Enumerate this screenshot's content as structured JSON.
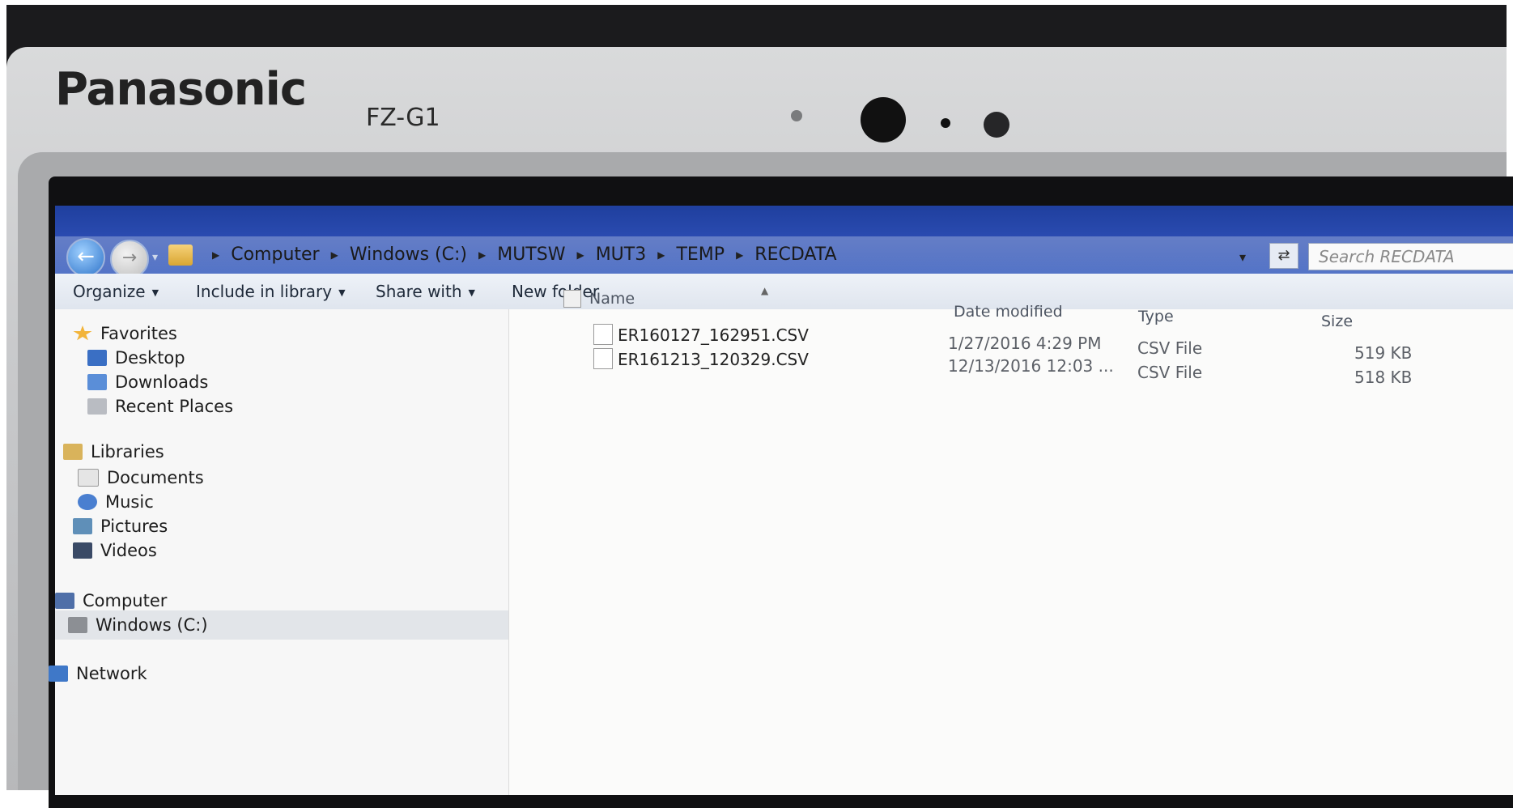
{
  "device": {
    "brand": "Panasonic",
    "model": "FZ-G1"
  },
  "explorer": {
    "breadcrumb": [
      "Computer",
      "Windows (C:)",
      "MUTSW",
      "MUT3",
      "TEMP",
      "RECDATA"
    ],
    "search_placeholder": "Search RECDATA",
    "toolbar": {
      "organize": "Organize",
      "include_in_library": "Include in library",
      "share_with": "Share with",
      "new_folder": "New folder"
    },
    "nav": {
      "favorites": "Favorites",
      "desktop": "Desktop",
      "downloads": "Downloads",
      "recent_places": "Recent Places",
      "libraries": "Libraries",
      "documents": "Documents",
      "music": "Music",
      "pictures": "Pictures",
      "videos": "Videos",
      "computer": "Computer",
      "windows_c": "Windows (C:)",
      "network": "Network"
    },
    "columns": {
      "name": "Name",
      "date_modified": "Date modified",
      "type": "Type",
      "size": "Size"
    },
    "files": [
      {
        "name": "ER160127_162951.CSV",
        "date": "1/27/2016 4:29 PM",
        "type": "CSV File",
        "size": "519 KB"
      },
      {
        "name": "ER161213_120329.CSV",
        "date": "12/13/2016 12:03 ...",
        "type": "CSV File",
        "size": "518 KB"
      }
    ]
  },
  "colors": {
    "titlebar": "#2a4bb0",
    "window_bg": "#f4f4f2",
    "bezel": "#c9cacc"
  }
}
